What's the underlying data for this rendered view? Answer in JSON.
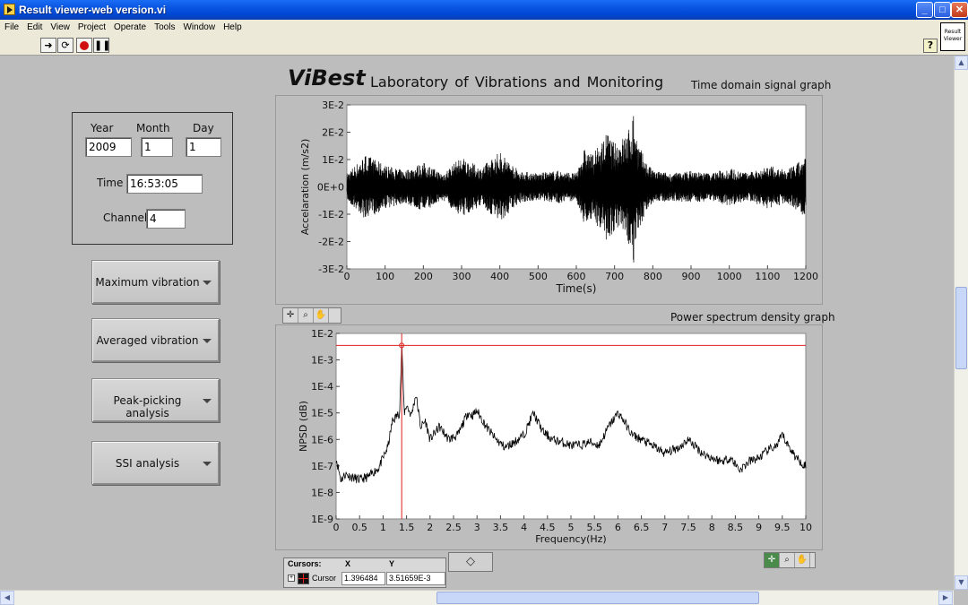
{
  "window": {
    "title": "Result viewer-web version.vi",
    "controls": {
      "minimize": "_",
      "maximize": "□",
      "close": "✕"
    }
  },
  "menu": [
    "File",
    "Edit",
    "View",
    "Project",
    "Operate",
    "Tools",
    "Window",
    "Help"
  ],
  "toolbar": {
    "icons": [
      "run-arrow-icon",
      "run-continuously-icon",
      "abort-icon",
      "pause-icon"
    ],
    "help_label": "?",
    "vi_icon_text": "Result Viewer"
  },
  "header": {
    "brand": "ViBest",
    "lab": "Laboratory of Vibrations and Monitoring"
  },
  "date_panel": {
    "year_label": "Year",
    "year": "2009",
    "month_label": "Month",
    "month": "1",
    "day_label": "Day",
    "day": "1",
    "time_label": "Time",
    "time": "16:53:05",
    "channel_label": "Channel",
    "channel": "4"
  },
  "buttons": [
    {
      "label": "Maximum vibration"
    },
    {
      "label": "Averaged vibration"
    },
    {
      "label": "Peak-picking analysis"
    },
    {
      "label": "SSI analysis"
    }
  ],
  "charts": {
    "time_caption": "Time domain signal graph",
    "psd_caption": "Power spectrum density graph"
  },
  "chart_data": [
    {
      "type": "line",
      "title": "Time domain signal graph",
      "xlabel": "Time(s)",
      "ylabel": "Accelaration (m/s2)",
      "xlim": [
        0,
        1200
      ],
      "ylim": [
        -0.03,
        0.03
      ],
      "x_ticks": [
        "0",
        "100",
        "200",
        "300",
        "400",
        "500",
        "600",
        "700",
        "800",
        "900",
        "1000",
        "1100",
        "1200"
      ],
      "y_ticks": [
        "3E-2",
        "2E-2",
        "1E-2",
        "0E+0",
        "-1E-2",
        "-2E-2",
        "-3E-2"
      ],
      "grid": false,
      "series": [
        {
          "envelope_time_s": [
            0,
            50,
            100,
            150,
            200,
            250,
            300,
            350,
            400,
            450,
            500,
            550,
            600,
            620,
            640,
            660,
            680,
            700,
            720,
            740,
            750,
            760,
            780,
            800,
            850,
            900,
            950,
            1000,
            1050,
            1100,
            1150,
            1200
          ],
          "envelope_amplitude": [
            0.005,
            0.012,
            0.008,
            0.006,
            0.009,
            0.005,
            0.011,
            0.007,
            0.013,
            0.006,
            0.005,
            0.006,
            0.005,
            0.014,
            0.012,
            0.015,
            0.02,
            0.016,
            0.018,
            0.022,
            0.028,
            0.017,
            0.01,
            0.006,
            0.005,
            0.006,
            0.005,
            0.007,
            0.005,
            0.008,
            0.006,
            0.011
          ]
        }
      ]
    },
    {
      "type": "line",
      "title": "Power spectrum density graph",
      "xlabel": "Frequency(Hz)",
      "ylabel": "NPSD (dB)",
      "xlim": [
        0,
        10
      ],
      "ylim": [
        1e-09,
        0.01
      ],
      "yscale": "log",
      "x_ticks": [
        "0",
        "0.5",
        "1",
        "1.5",
        "2",
        "2.5",
        "3",
        "3.5",
        "4",
        "4.5",
        "5",
        "5.5",
        "6",
        "6.5",
        "7",
        "7.5",
        "8",
        "8.5",
        "9",
        "9.5",
        "10"
      ],
      "y_ticks": [
        "1E-2",
        "1E-3",
        "1E-4",
        "1E-5",
        "1E-6",
        "1E-7",
        "1E-8",
        "1E-9"
      ],
      "grid": false,
      "series": [
        {
          "x": [
            0,
            0.1,
            0.2,
            0.3,
            0.5,
            0.7,
            0.8,
            0.9,
            1.0,
            1.1,
            1.2,
            1.3,
            1.35,
            1.4,
            1.45,
            1.5,
            1.6,
            1.7,
            1.8,
            1.9,
            2.0,
            2.2,
            2.4,
            2.6,
            2.8,
            2.9,
            3.0,
            3.2,
            3.4,
            3.6,
            3.8,
            4.0,
            4.2,
            4.4,
            4.6,
            4.8,
            5.0,
            5.2,
            5.4,
            5.6,
            5.8,
            6.0,
            6.1,
            6.3,
            6.5,
            6.8,
            7.0,
            7.3,
            7.5,
            7.8,
            8.0,
            8.2,
            8.4,
            8.6,
            8.8,
            9.0,
            9.2,
            9.4,
            9.5,
            9.6,
            9.8,
            10.0
          ],
          "y": [
            2e-07,
            3e-08,
            5e-08,
            4e-08,
            3e-08,
            4e-08,
            6e-08,
            8e-08,
            2e-07,
            5e-07,
            5e-06,
            8e-06,
            1e-05,
            0.0035,
            1e-05,
            2e-05,
            8e-06,
            5e-05,
            3e-06,
            5e-06,
            1e-06,
            3e-06,
            1e-06,
            1.5e-06,
            1e-05,
            8e-06,
            1.2e-05,
            3e-06,
            1e-06,
            5e-07,
            8e-07,
            1.5e-06,
            1e-05,
            2e-06,
            1e-06,
            8e-07,
            6e-07,
            6e-07,
            8e-07,
            6e-07,
            3e-06,
            1e-05,
            6e-06,
            1.5e-06,
            1e-06,
            5e-07,
            3e-07,
            5e-07,
            1e-06,
            3e-07,
            2e-07,
            1.5e-07,
            2e-07,
            7e-08,
            1.5e-07,
            2e-07,
            4e-07,
            6e-07,
            1.5e-06,
            7e-07,
            2e-07,
            1e-07
          ]
        }
      ],
      "cursor": {
        "name": "Cursor",
        "x": 1.396484,
        "y": 0.00351659
      }
    }
  ],
  "cursor_legend": {
    "title": "Cursors:",
    "col_x": "X",
    "col_y": "Y",
    "name": "Cursor",
    "x": "1.396484",
    "y": "3.51659E-3"
  },
  "colors": {
    "signal": "#000000",
    "cursor": "#e02020",
    "panel": "#bdbdbd"
  }
}
